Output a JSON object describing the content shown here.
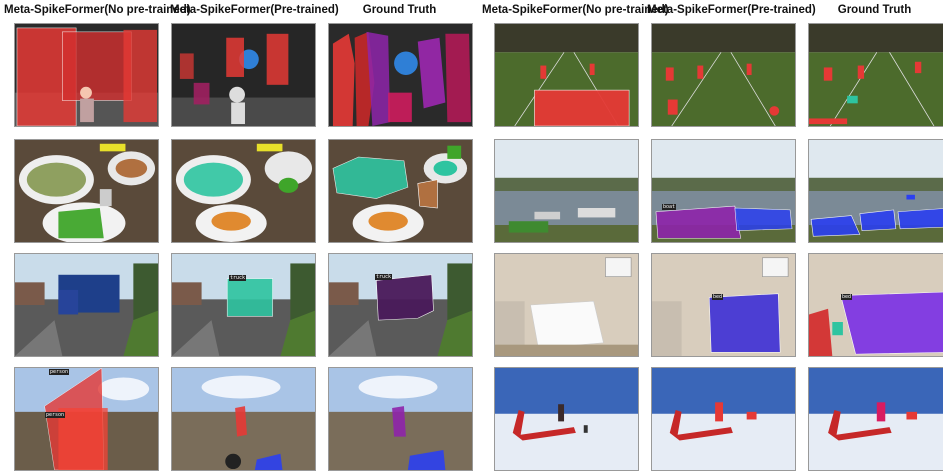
{
  "headers": {
    "left": [
      "Meta-SpikeFormer(No pre-trained)",
      "Meta-SpikeFormer(Pre-trained)",
      "Ground Truth"
    ],
    "right": [
      "Meta-SpikeFormer(No pre-trained)",
      "Meta-SpikeFormer(Pre-trained)",
      "Ground Truth"
    ]
  },
  "tags": {
    "person": "person",
    "truck": "truck",
    "boat": "boat",
    "bed": "bed"
  },
  "colors": {
    "mask_red": "#e53935",
    "mask_teal": "#2ec4a0",
    "mask_purple": "#8e24aa",
    "mask_blue": "#2b3ff0",
    "mask_green": "#3fa52a"
  }
}
